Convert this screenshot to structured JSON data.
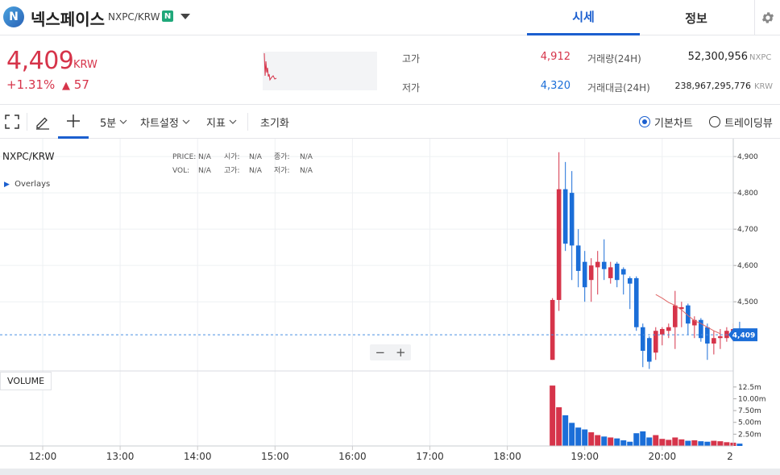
{
  "header": {
    "logo_letter": "N",
    "coin_name": "넥스페이스",
    "pair": "NXPC/KRW",
    "badge": "N",
    "tabs": [
      {
        "label": "시세"
      },
      {
        "label": "정보"
      }
    ]
  },
  "summary": {
    "price": "4,409",
    "unit": "KRW",
    "change_pct": "+1.31%",
    "change_arrow": "▲",
    "change_abs": "57",
    "high_label": "고가",
    "high_value": "4,912",
    "low_label": "저가",
    "low_value": "4,320",
    "volume_label": "거래량(24H)",
    "volume_value": "52,300,956",
    "volume_unit": "NXPC",
    "amount_label": "거래대금(24H)",
    "amount_value": "238,967,295,776",
    "amount_unit": "KRW",
    "colors": {
      "up": "#d6344a",
      "down": "#1b6ed8"
    }
  },
  "toolbar": {
    "interval": "5분",
    "chart_settings": "차트설정",
    "indicators": "지표",
    "reset": "초기화",
    "basic_chart": "기본차트",
    "tradingview": "트레이딩뷰"
  },
  "chart_legend": {
    "pair": "NXPC/KRW",
    "price_label": "PRICE:",
    "price_value": "N/A",
    "open_label": "시가:",
    "open_value": "N/A",
    "close_label": "종가:",
    "close_value": "N/A",
    "vol_label": "VOL:",
    "vol_value": "N/A",
    "high_label": "고가:",
    "high_value": "N/A",
    "low_label": "저가:",
    "low_value": "N/A",
    "overlays": "Overlays",
    "volume_pane": "VOLUME"
  },
  "chart_data": {
    "type": "candlestick",
    "x_ticks": [
      "12:00",
      "13:00",
      "14:00",
      "15:00",
      "16:00",
      "17:00",
      "18:00",
      "19:00",
      "20:00",
      "2"
    ],
    "y_ticks": [
      "4,900",
      "4,800",
      "4,700",
      "4,600",
      "4,500"
    ],
    "ylim": [
      4305,
      4918
    ],
    "current_price": 4409,
    "current_price_label": "4,409",
    "volume_ticks": [
      "12.5m",
      "10.00m",
      "7.50m",
      "5.00m",
      "2.50m"
    ],
    "volume_ylim": [
      0,
      13500000
    ],
    "candles_start": "18:35",
    "candle_interval_min": 5,
    "candles": [
      {
        "o": 4340,
        "h": 4510,
        "l": 4340,
        "c": 4505
      },
      {
        "o": 4505,
        "h": 4912,
        "l": 4475,
        "c": 4810
      },
      {
        "o": 4810,
        "h": 4885,
        "l": 4640,
        "c": 4660
      },
      {
        "o": 4800,
        "h": 4860,
        "l": 4560,
        "c": 4655
      },
      {
        "o": 4655,
        "h": 4700,
        "l": 4540,
        "c": 4585
      },
      {
        "o": 4610,
        "h": 4640,
        "l": 4500,
        "c": 4540
      },
      {
        "o": 4560,
        "h": 4620,
        "l": 4500,
        "c": 4600
      },
      {
        "o": 4595,
        "h": 4640,
        "l": 4520,
        "c": 4610
      },
      {
        "o": 4610,
        "h": 4672,
        "l": 4560,
        "c": 4590
      },
      {
        "o": 4565,
        "h": 4610,
        "l": 4550,
        "c": 4595
      },
      {
        "o": 4605,
        "h": 4610,
        "l": 4540,
        "c": 4560
      },
      {
        "o": 4590,
        "h": 4595,
        "l": 4520,
        "c": 4575
      },
      {
        "o": 4565,
        "h": 4570,
        "l": 4480,
        "c": 4550
      },
      {
        "o": 4565,
        "h": 4570,
        "l": 4420,
        "c": 4430
      },
      {
        "o": 4430,
        "h": 4440,
        "l": 4320,
        "c": 4365
      },
      {
        "o": 4400,
        "h": 4405,
        "l": 4315,
        "c": 4335
      },
      {
        "o": 4360,
        "h": 4430,
        "l": 4340,
        "c": 4420
      },
      {
        "o": 4410,
        "h": 4430,
        "l": 4380,
        "c": 4425
      },
      {
        "o": 4420,
        "h": 4440,
        "l": 4400,
        "c": 4430
      },
      {
        "o": 4430,
        "h": 4530,
        "l": 4370,
        "c": 4490
      },
      {
        "o": 4480,
        "h": 4500,
        "l": 4430,
        "c": 4485
      },
      {
        "o": 4490,
        "h": 4495,
        "l": 4410,
        "c": 4440
      },
      {
        "o": 4435,
        "h": 4460,
        "l": 4400,
        "c": 4450
      },
      {
        "o": 4450,
        "h": 4455,
        "l": 4390,
        "c": 4400
      },
      {
        "o": 4430,
        "h": 4440,
        "l": 4340,
        "c": 4385
      },
      {
        "o": 4385,
        "h": 4420,
        "l": 4355,
        "c": 4400
      },
      {
        "o": 4400,
        "h": 4425,
        "l": 4370,
        "c": 4405
      },
      {
        "o": 4400,
        "h": 4430,
        "l": 4390,
        "c": 4420
      },
      {
        "o": 4405,
        "h": 4440,
        "l": 4390,
        "c": 4425
      },
      {
        "o": 4420,
        "h": 4445,
        "l": 4395,
        "c": 4409
      }
    ],
    "volumes": [
      12800000,
      8200000,
      6500000,
      4900000,
      3900000,
      3500000,
      2900000,
      2300000,
      2000000,
      1800000,
      1600000,
      1200000,
      900000,
      2700000,
      3100000,
      1800000,
      2300000,
      1500000,
      1300000,
      1800000,
      1400000,
      1100000,
      1200000,
      1000000,
      900000,
      1100000,
      1000000,
      800000,
      700000,
      500000
    ],
    "ma_values": [
      4520,
      4510,
      4498,
      4490,
      4478,
      4462,
      4448,
      4440,
      4430,
      4420,
      4412
    ],
    "ma_start_index": 16
  }
}
